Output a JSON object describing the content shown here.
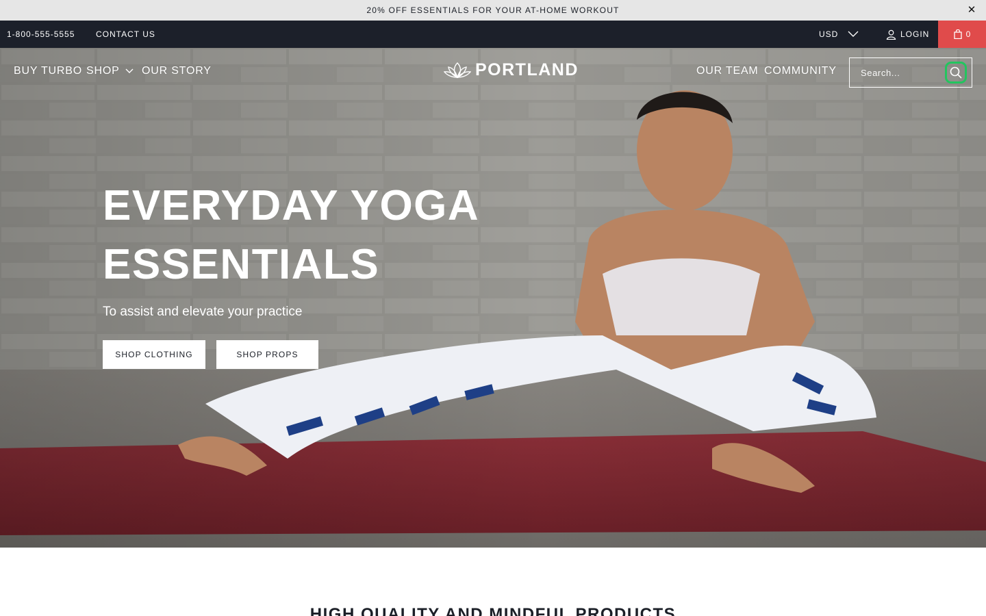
{
  "announcement": {
    "text": "20% OFF ESSENTIALS FOR YOUR AT-HOME WORKOUT",
    "close_label": "✕"
  },
  "topbar": {
    "phone": "1-800-555-5555",
    "contact": "CONTACT US",
    "currency": "USD",
    "login": "LOGIN",
    "cart_count": "0",
    "cart_color": "#e04b4b",
    "bar_color": "#1c202a"
  },
  "nav": {
    "left": [
      "BUY TURBO",
      "SHOP",
      "OUR STORY"
    ],
    "right": [
      "OUR TEAM",
      "COMMUNITY"
    ]
  },
  "logo": {
    "text": "PORTLAND",
    "icon": "lotus-icon"
  },
  "search": {
    "placeholder": "Search...",
    "icon": "search-icon",
    "focus_ring_color": "#22c55e"
  },
  "hero": {
    "title_line1": "EVERYDAY YOGA",
    "title_line2": "ESSENTIALS",
    "subtitle": "To assist and elevate your practice",
    "buttons": [
      "SHOP CLOTHING",
      "SHOP PROPS"
    ]
  },
  "section": {
    "heading": "HIGH QUALITY AND MINDFUL PRODUCTS"
  }
}
